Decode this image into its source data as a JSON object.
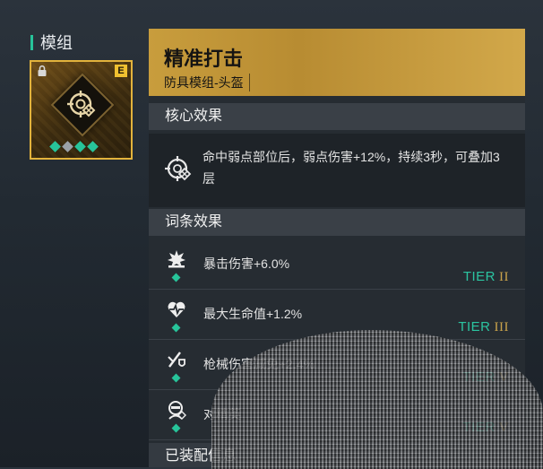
{
  "sidebar": {
    "section_label": "模组",
    "mod_card": {
      "rarity": "E",
      "slots": [
        "filled",
        "empty",
        "filled",
        "filled"
      ],
      "icon": "crosshair-target-icon",
      "locked_icon": "lock-icon",
      "frame_color": "#e3b33c"
    }
  },
  "header": {
    "title": "精准打击",
    "subtitle": "防具模组-头盔",
    "bg_color": "#c89d3d"
  },
  "core_effect": {
    "heading": "核心效果",
    "icon": "crosshair-target-icon",
    "text": "命中弱点部位后，弱点伤害+12%，持续3秒，可叠加3层"
  },
  "affixes": {
    "heading": "词条效果",
    "items": [
      {
        "icon": "burst-icon",
        "text": "暴击伤害+6.0%",
        "tier_label": "TIER",
        "tier_num": "II"
      },
      {
        "icon": "heart-pulse-icon",
        "text": "最大生命值+1.2%",
        "tier_label": "TIER",
        "tier_num": "III"
      },
      {
        "icon": "gun-shield-icon",
        "text": "枪械伤害减免+2.4%",
        "tier_label": "TIER",
        "tier_num": "V"
      },
      {
        "icon": "enemy-head-icon",
        "text": "对精英",
        "tier_label": "TIER",
        "tier_num": "V"
      }
    ],
    "tier_color": "#2bc4a0",
    "slot_color": "#27c49a"
  },
  "equip_info": {
    "heading": "已装配信息"
  }
}
